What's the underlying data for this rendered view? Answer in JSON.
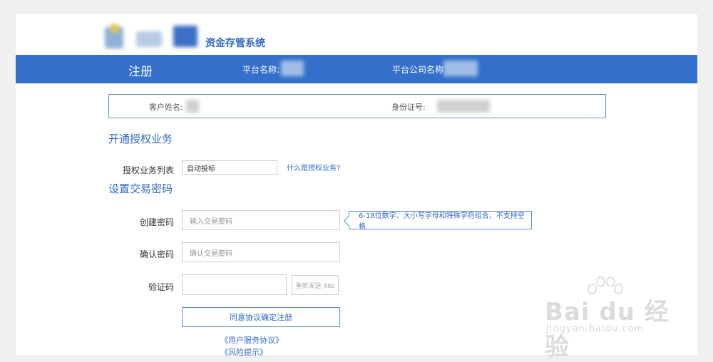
{
  "header": {
    "system_name": "资金存管系统"
  },
  "navbar": {
    "title": "注册",
    "platform_name_label": "平台名称:",
    "platform_company_label": "平台公司名称"
  },
  "customer_info": {
    "name_label": "客户姓名:",
    "id_label": "身份证号:"
  },
  "authorization": {
    "section_title": "开通授权业务",
    "list_label": "授权业务列表",
    "list_value": "自动投标",
    "help_link": "什么是授权业务?"
  },
  "password": {
    "section_title": "设置交易密码",
    "create_label": "创建密码",
    "create_placeholder": "输入交易密码",
    "rule_tip": "6-18位数字、大小写字母和特殊字符组合，不支持空格",
    "confirm_label": "确认密码",
    "confirm_placeholder": "确认交易密码",
    "code_label": "验证码",
    "resend_label": "重新发送 46s"
  },
  "actions": {
    "submit_label": "同意协议确定注册",
    "agreement_link": "《用户服务协议》",
    "risk_link": "《风险提示》"
  },
  "watermark": {
    "brand_text": "Bai du 经验",
    "url_text": "jingyan.baidu.com"
  }
}
